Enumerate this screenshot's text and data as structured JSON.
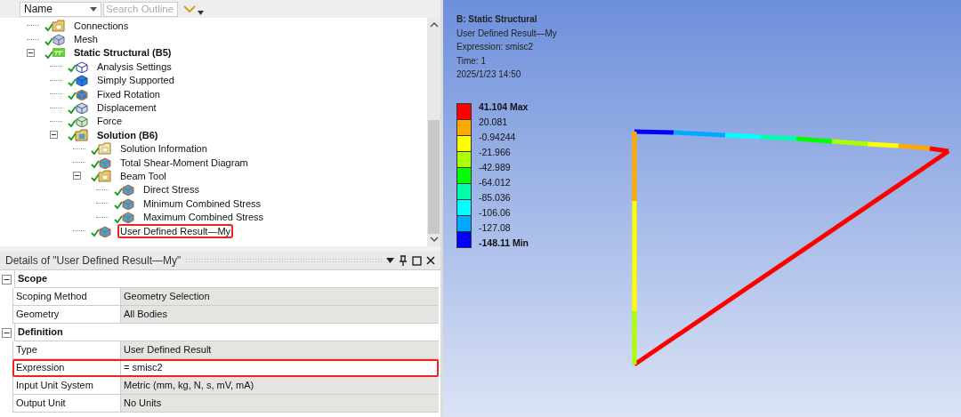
{
  "toolbar": {
    "sort_field": "Name",
    "search": {
      "placeholder": "Search Outline"
    }
  },
  "tree": [
    {
      "label": "Connections",
      "kind": "folder",
      "solved": true,
      "bold": false,
      "highlighted": false
    },
    {
      "label": "Mesh",
      "kind": "mesh",
      "solved": true,
      "bold": false,
      "highlighted": false
    },
    {
      "label": "Static Structural (B5)",
      "kind": "analysis",
      "solved": true,
      "bold": true,
      "highlighted": false,
      "expanded": true,
      "children": [
        {
          "label": "Analysis Settings",
          "kind": "settings",
          "solved": true,
          "bold": false,
          "highlighted": false
        },
        {
          "label": "Simply Supported",
          "kind": "support",
          "solved": true,
          "bold": false,
          "highlighted": false
        },
        {
          "label": "Fixed Rotation",
          "kind": "rotation",
          "solved": true,
          "bold": false,
          "highlighted": false
        },
        {
          "label": "Displacement",
          "kind": "displacement",
          "solved": true,
          "bold": false,
          "highlighted": false
        },
        {
          "label": "Force",
          "kind": "force",
          "solved": true,
          "bold": false,
          "highlighted": false
        },
        {
          "label": "Solution (B6)",
          "kind": "solution",
          "solved": true,
          "bold": true,
          "highlighted": false,
          "expanded": true,
          "children": [
            {
              "label": "Solution Information",
              "kind": "info",
              "solved": true,
              "bold": false,
              "highlighted": false
            },
            {
              "label": "Total Shear-Moment Diagram",
              "kind": "result",
              "solved": true,
              "bold": false,
              "highlighted": false
            },
            {
              "label": "Beam Tool",
              "kind": "folder",
              "solved": true,
              "bold": false,
              "highlighted": false,
              "expanded": true,
              "children": [
                {
                  "label": "Direct Stress",
                  "kind": "result",
                  "solved": true,
                  "bold": false,
                  "highlighted": false
                },
                {
                  "label": "Minimum Combined Stress",
                  "kind": "result",
                  "solved": true,
                  "bold": false,
                  "highlighted": false
                },
                {
                  "label": "Maximum Combined Stress",
                  "kind": "result",
                  "solved": true,
                  "bold": false,
                  "highlighted": false
                }
              ]
            },
            {
              "label": "User Defined Result—My",
              "kind": "result",
              "solved": true,
              "bold": false,
              "highlighted": true
            }
          ]
        }
      ]
    }
  ],
  "details": {
    "title": "Details of \"User Defined Result—My\"",
    "sections": [
      {
        "title": "Scope",
        "expanded": true,
        "rows": [
          {
            "label": "Scoping Method",
            "value": "Geometry Selection",
            "highlighted": false
          },
          {
            "label": "Geometry",
            "value": "All Bodies",
            "highlighted": false
          }
        ]
      },
      {
        "title": "Definition",
        "expanded": true,
        "rows": [
          {
            "label": "Type",
            "value": "User Defined Result",
            "highlighted": false
          },
          {
            "label": "Expression",
            "value": "= smisc2",
            "highlighted": true
          },
          {
            "label": "Input Unit System",
            "value": "Metric (mm, kg, N, s, mV, mA)",
            "highlighted": false
          },
          {
            "label": "Output Unit",
            "value": "No Units",
            "highlighted": false
          }
        ]
      }
    ]
  },
  "viewport": {
    "info": [
      "B: Static Structural",
      "User Defined Result—My",
      "Expression: smisc2",
      "Time: 1",
      "2025/1/23 14:50"
    ],
    "legend": {
      "labels": [
        "41.104 Max",
        "20.081",
        "-0.94244",
        "-21.966",
        "-42.989",
        "-64.012",
        "-85.036",
        "-106.06",
        "-127.08",
        "-148.11 Min"
      ],
      "bands": [
        {
          "color": "#ff0000"
        },
        {
          "color": "#ffaa00"
        },
        {
          "color": "#ffff00"
        },
        {
          "color": "#aaff00"
        },
        {
          "color": "#00ff00"
        },
        {
          "color": "#00ffaa"
        },
        {
          "color": "#00ffff"
        },
        {
          "color": "#00aaff"
        },
        {
          "color": "#0000ff"
        }
      ]
    }
  }
}
